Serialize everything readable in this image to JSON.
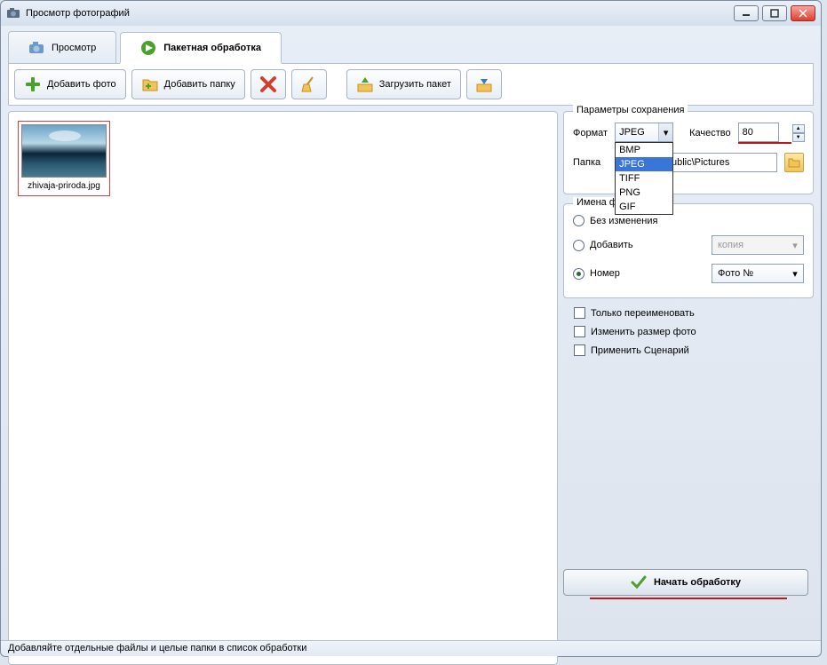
{
  "title": "Просмотр фотографий",
  "tabs": {
    "view": "Просмотр",
    "batch": "Пакетная обработка"
  },
  "toolbar": {
    "add_photo": "Добавить фото",
    "add_folder": "Добавить папку",
    "upload_pack": "Загрузить пакет"
  },
  "thumb": {
    "filename": "zhivaja-priroda.jpg"
  },
  "save_params": {
    "title": "Параметры сохранения",
    "format_label": "Формат",
    "format_value": "JPEG",
    "format_options": [
      "BMP",
      "JPEG",
      "TIFF",
      "PNG",
      "GIF"
    ],
    "quality_label": "Качество",
    "quality_value": "80",
    "folder_label": "Папка",
    "folder_value": "ublic\\Pictures"
  },
  "filenames": {
    "title": "Имена файлов",
    "no_change": "Без изменения",
    "add": "Добавить",
    "add_suffix": "копия",
    "number": "Номер",
    "number_template": "Фото №"
  },
  "options": {
    "rename_only": "Только переименовать",
    "resize": "Изменить размер фото",
    "scenario": "Применить Сценарий"
  },
  "start": "Начать обработку",
  "statusbar": "Добавляйте отдельные файлы и целые папки в список обработки"
}
